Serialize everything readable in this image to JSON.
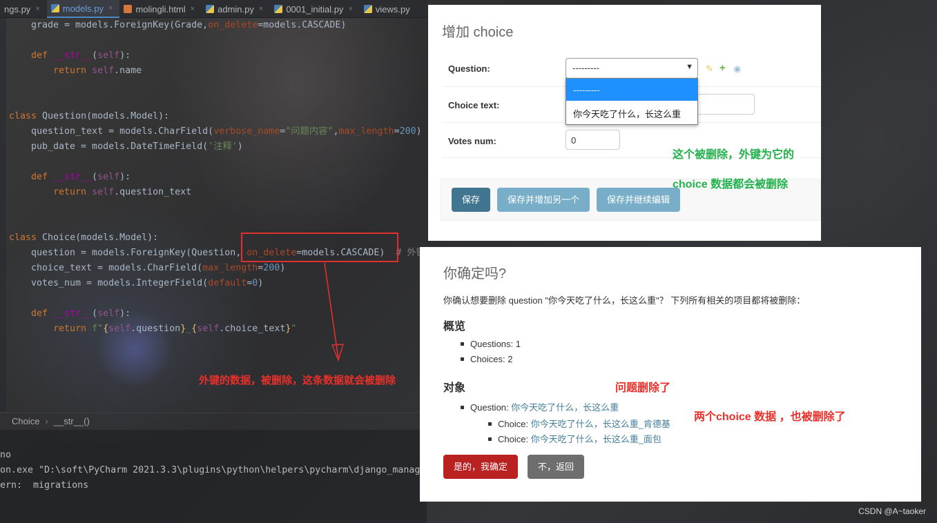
{
  "ide": {
    "tabs": [
      {
        "label": "ngs.py",
        "icon": "python-file-icon"
      },
      {
        "label": "models.py",
        "icon": "python-file-icon"
      },
      {
        "label": "molingli.html",
        "icon": "html-file-icon"
      },
      {
        "label": "admin.py",
        "icon": "python-file-icon"
      },
      {
        "label": "0001_initial.py",
        "icon": "python-file-icon"
      },
      {
        "label": "views.py",
        "icon": "python-file-icon"
      }
    ],
    "close_glyph": "×",
    "breadcrumb": [
      "Choice",
      "__str__()"
    ],
    "breadcrumb_sep": "›",
    "terminal": [
      "no",
      "on.exe \"D:\\soft\\PyCharm 2021.3.3\\plugins\\python\\helpers\\pycharm\\django_manage",
      "ern:  migrations"
    ]
  },
  "annotations": {
    "code_note": "外键的数据，被删除，这条数据就会被删除",
    "green_note_1": "这个被删除，外键为它的",
    "green_note_2": "choice 数据都会被删除",
    "question_deleted": "问题删除了",
    "choices_deleted": "两个choice 数据 ，也被删除了"
  },
  "add_form": {
    "title": "增加 choice",
    "question_label": "Question:",
    "question_value": "---------",
    "dropdown_options": [
      "---------",
      "你今天吃了什么，长这么重"
    ],
    "choice_text_label": "Choice text:",
    "votes_label": "Votes num:",
    "votes_value": "0",
    "buttons": {
      "save": "保存",
      "save_add": "保存并增加另一个",
      "save_continue": "保存并继续编辑"
    },
    "icons": {
      "edit": "pencil-icon",
      "add": "plus-icon",
      "view": "eye-icon"
    }
  },
  "delete_confirm": {
    "title": "你确定吗?",
    "message": "你确认想要删除 question \"你今天吃了什么，长这么重\"？ 下列所有相关的项目都将被删除：",
    "summary_heading": "概览",
    "summary": [
      "Questions: 1",
      "Choices: 2"
    ],
    "objects_heading": "对象",
    "question_prefix": "Question: ",
    "question_link": "你今天吃了什么，长这么重",
    "choice_prefix": "Choice: ",
    "choice_links": [
      "你今天吃了什么，长这么重_肯德基",
      "你今天吃了什么，长这么重_面包"
    ],
    "confirm_button": "是的，我确定",
    "cancel_button": "不，返回"
  },
  "watermark": "CSDN @A~taoker",
  "colors": {
    "django_header": "#417690",
    "danger": "#ba2121",
    "link": "#447e9b",
    "annotation_red": "#e8302a",
    "annotation_green": "#22b14c"
  }
}
